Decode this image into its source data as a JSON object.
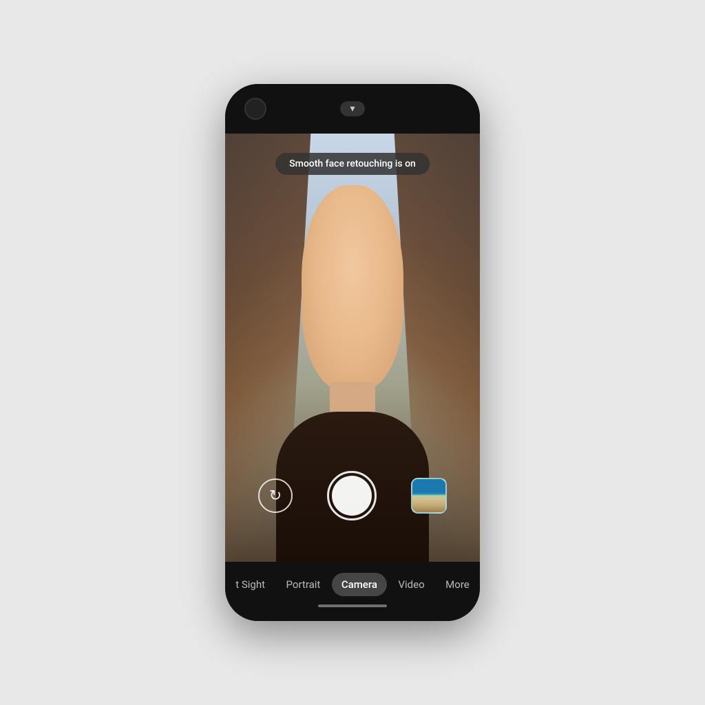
{
  "phone": {
    "status_bar": {
      "dropdown_label": "chevron-down"
    },
    "viewfinder": {
      "retouching_badge": "Smooth face retouching is on"
    },
    "controls": {
      "flip_icon": "↻",
      "shutter_label": "Take photo",
      "gallery_label": "Last photo"
    },
    "mode_tabs": [
      {
        "id": "night-sight",
        "label": "t Sight",
        "active": false
      },
      {
        "id": "portrait",
        "label": "Portrait",
        "active": false
      },
      {
        "id": "camera",
        "label": "Camera",
        "active": true
      },
      {
        "id": "video",
        "label": "Video",
        "active": false
      },
      {
        "id": "more",
        "label": "More",
        "active": false
      }
    ],
    "colors": {
      "active_tab_bg": "rgba(255,255,255,0.22)",
      "badge_bg": "rgba(50,50,50,0.85)"
    }
  }
}
